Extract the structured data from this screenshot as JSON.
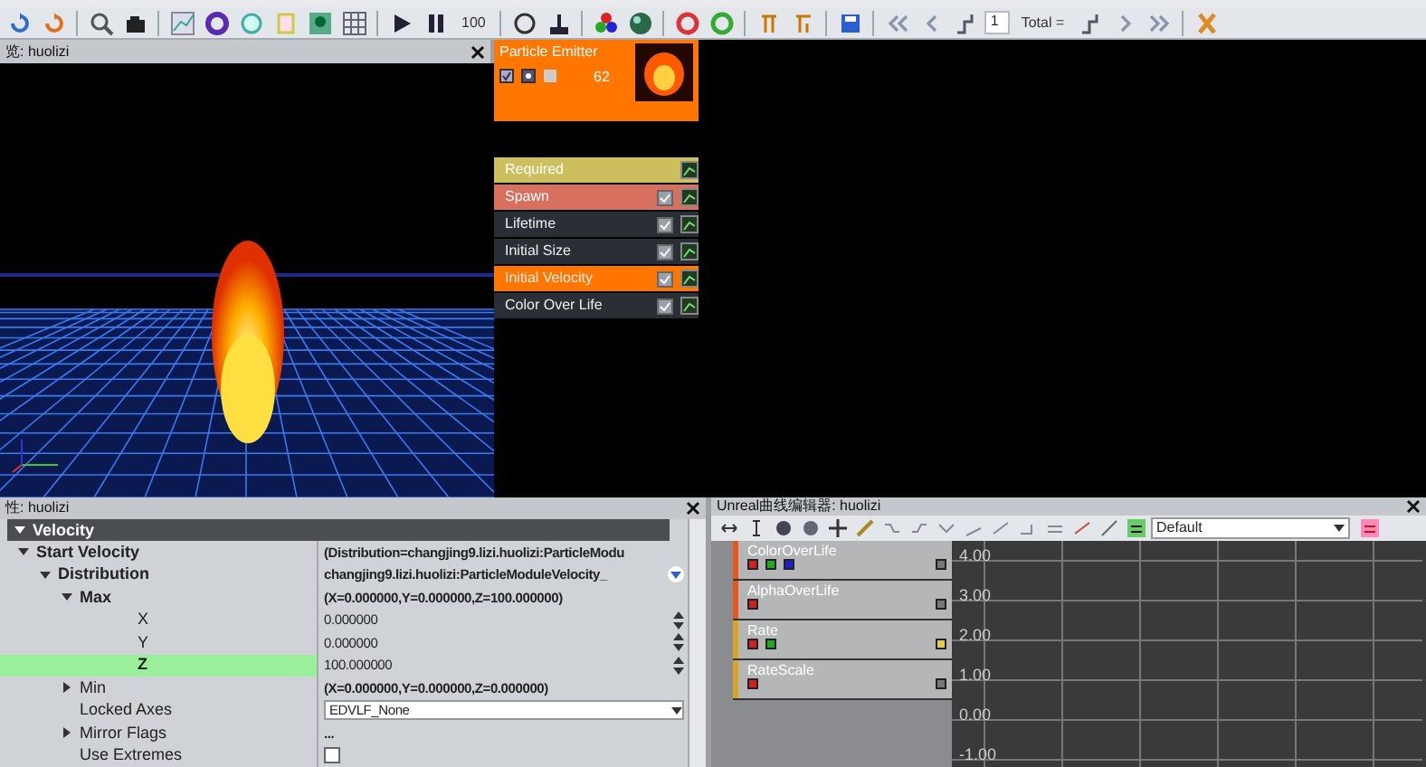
{
  "toolbar": {
    "speed": "100",
    "lod_index": "1",
    "lod_total": "Total ="
  },
  "viewport": {
    "title": "览: huolizi"
  },
  "emitter": {
    "title": "Particle Emitter",
    "count": "62",
    "modules": [
      {
        "name": "Required",
        "kind": "required",
        "color": "#cdbf5e"
      },
      {
        "name": "Spawn",
        "kind": "module",
        "color": "#d7705e",
        "enabled": true
      },
      {
        "name": "Lifetime",
        "kind": "module",
        "color": "#2a2e35",
        "enabled": true
      },
      {
        "name": "Initial Size",
        "kind": "module",
        "color": "#2a2e35",
        "enabled": true
      },
      {
        "name": "Initial Velocity",
        "kind": "module",
        "color": "#ff7700",
        "enabled": true
      },
      {
        "name": "Color Over Life",
        "kind": "module",
        "color": "#2a2e35",
        "enabled": true
      }
    ]
  },
  "properties": {
    "title": "性: huolizi",
    "category": "Velocity",
    "rows": [
      {
        "label": "Start Velocity",
        "expanded": true,
        "kind": "text",
        "value": "(Distribution=changjing9.lizi.huolizi:ParticleModu",
        "children": [
          {
            "label": "Distribution",
            "expanded": true,
            "kind": "link",
            "value": "changjing9.lizi.huolizi:ParticleModuleVelocity_",
            "children": [
              {
                "label": "Max",
                "expanded": true,
                "kind": "text",
                "value": "(X=0.000000,Y=0.000000,Z=100.000000)",
                "children": [
                  {
                    "label": "X",
                    "kind": "spin",
                    "value": "0.000000",
                    "selected": false
                  },
                  {
                    "label": "Y",
                    "kind": "spin",
                    "value": "0.000000",
                    "selected": false
                  },
                  {
                    "label": "Z",
                    "kind": "spin",
                    "value": "100.000000",
                    "selected": true
                  }
                ]
              },
              {
                "label": "Min",
                "expanded": false,
                "kind": "text",
                "value": "(X=0.000000,Y=0.000000,Z=0.000000)"
              },
              {
                "label": "Locked Axes",
                "kind": "dropdown",
                "value": "EDVLF_None"
              },
              {
                "label": "Mirror Flags",
                "expanded": false,
                "kind": "text",
                "value": "..."
              },
              {
                "label": "Use Extremes",
                "kind": "checkbox",
                "checked": false
              }
            ]
          }
        ]
      }
    ]
  },
  "curve_editor": {
    "title": "Unreal曲线编辑器: huolizi",
    "preset": "Default",
    "curves": [
      {
        "name": "ColorOverLife",
        "color": "#e8571a",
        "swatches": [
          {
            "color": "#cc2222"
          },
          {
            "color": "#22aa22"
          },
          {
            "color": "#2222cc"
          }
        ],
        "end_swatch": {
          "color": "#777777"
        }
      },
      {
        "name": "AlphaOverLife",
        "color": "#e8571a",
        "swatches": [
          {
            "color": "#cc2222"
          }
        ],
        "end_swatch": {
          "color": "#777777"
        }
      },
      {
        "name": "Rate",
        "color": "#d9a520",
        "swatches": [
          {
            "color": "#cc2222"
          },
          {
            "color": "#22aa22"
          }
        ],
        "end_swatch": {
          "color": "#e6c84a"
        }
      },
      {
        "name": "RateScale",
        "color": "#d9a520",
        "swatches": [
          {
            "color": "#cc2222"
          }
        ],
        "end_swatch": {
          "color": "#777777"
        }
      }
    ],
    "y_labels": [
      "4.00",
      "3.00",
      "2.00",
      "1.00",
      "0.00",
      "-1.00"
    ]
  }
}
